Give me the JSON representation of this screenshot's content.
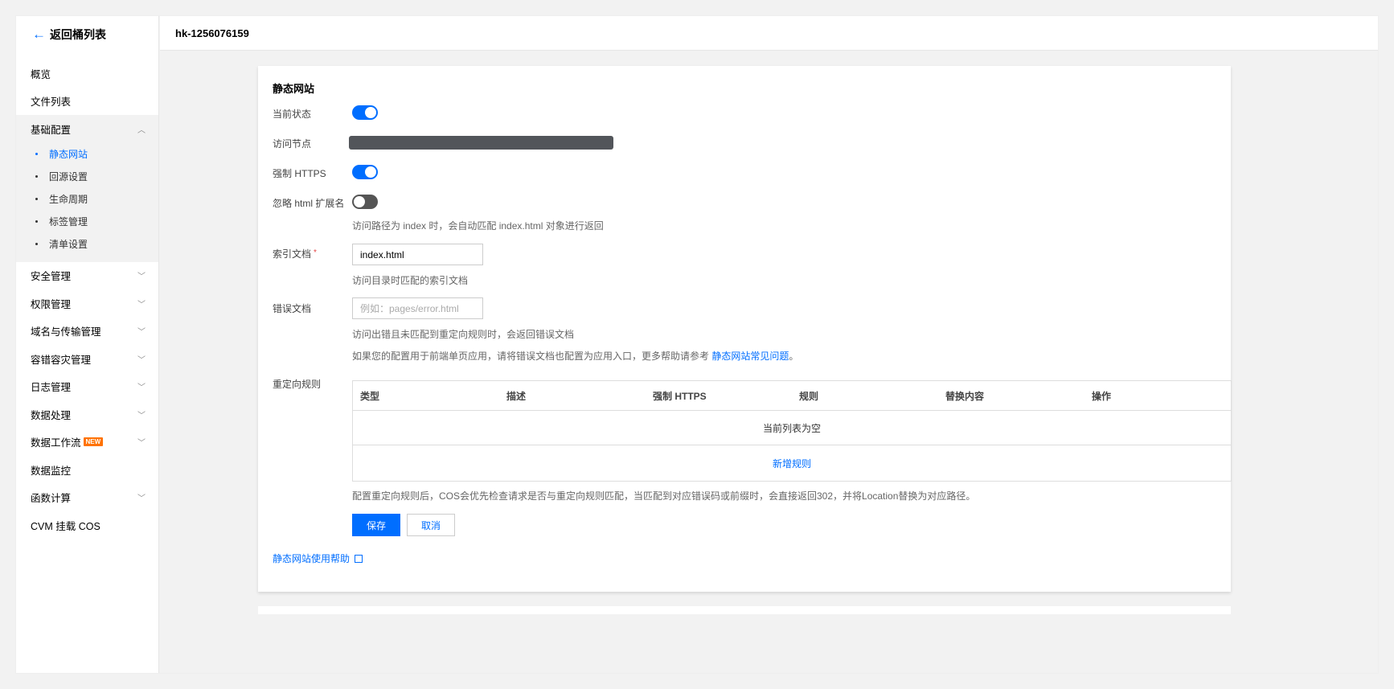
{
  "back_label": "返回桶列表",
  "bucket_name": "hk-1256076159",
  "sidebar": {
    "top_items": [
      {
        "label": "概览"
      },
      {
        "label": "文件列表"
      }
    ],
    "group": {
      "label": "基础配置",
      "items": [
        {
          "label": "静态网站",
          "active": true
        },
        {
          "label": "回源设置"
        },
        {
          "label": "生命周期"
        },
        {
          "label": "标签管理"
        },
        {
          "label": "清单设置"
        }
      ]
    },
    "bottom_items": [
      {
        "label": "安全管理",
        "has_chevron": true
      },
      {
        "label": "权限管理",
        "has_chevron": true
      },
      {
        "label": "域名与传输管理",
        "has_chevron": true
      },
      {
        "label": "容错容灾管理",
        "has_chevron": true
      },
      {
        "label": "日志管理",
        "has_chevron": true
      },
      {
        "label": "数据处理",
        "has_chevron": true
      },
      {
        "label": "数据工作流",
        "badge": "NEW",
        "has_chevron": true
      },
      {
        "label": "数据监控",
        "has_chevron": false
      },
      {
        "label": "函数计算",
        "has_chevron": true
      },
      {
        "label": "CVM 挂载 COS",
        "has_chevron": false
      }
    ]
  },
  "form": {
    "title": "静态网站",
    "status_label": "当前状态",
    "status_on": true,
    "endpoint_label": "访问节点",
    "https_label": "强制 HTTPS",
    "https_on": true,
    "ignore_ext_label": "忽略 html 扩展名",
    "ignore_ext_on": false,
    "ignore_ext_help": "访问路径为 index 时，会自动匹配 index.html 对象进行返回",
    "index_label": "索引文档",
    "index_required": "*",
    "index_value": "index.html",
    "index_help": "访问目录时匹配的索引文档",
    "error_label": "错误文档",
    "error_placeholder": "例如：pages/error.html",
    "error_help": "访问出错且未匹配到重定向规则时，会返回错误文档",
    "spa_help_prefix": "如果您的配置用于前端单页应用，请将错误文档也配置为应用入口，更多帮助请参考 ",
    "spa_help_link": "静态网站常见问题",
    "spa_help_suffix": "。",
    "redirect_label": "重定向规则",
    "table_headers": [
      "类型",
      "描述",
      "强制 HTTPS",
      "规则",
      "替换内容",
      "操作"
    ],
    "table_empty": "当前列表为空",
    "add_rule": "新增规则",
    "redirect_help": "配置重定向规则后，COS会优先检查请求是否与重定向规则匹配，当匹配到对应错误码或前缀时，会直接返回302，并将Location替换为对应路径。",
    "save_label": "保存",
    "cancel_label": "取消",
    "help_link": "静态网站使用帮助"
  },
  "colors": {
    "accent": "#006eff",
    "badge": "#ff7200",
    "required": "#e54545"
  }
}
